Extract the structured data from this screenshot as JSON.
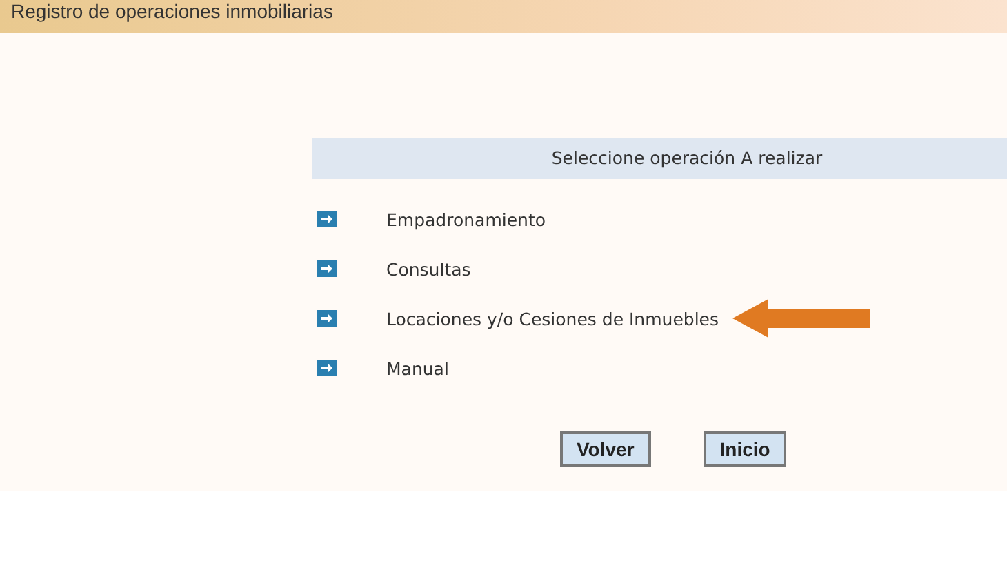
{
  "header": {
    "title": "Registro de operaciones inmobiliarias"
  },
  "panel": {
    "heading": "Seleccione operación A realizar",
    "items": [
      {
        "label": "Empadronamiento",
        "pointed": false
      },
      {
        "label": "Consultas",
        "pointed": false
      },
      {
        "label": "Locaciones y/o Cesiones de Inmuebles",
        "pointed": true
      },
      {
        "label": "Manual",
        "pointed": false
      }
    ]
  },
  "buttons": [
    "Volver",
    "Inicio"
  ]
}
